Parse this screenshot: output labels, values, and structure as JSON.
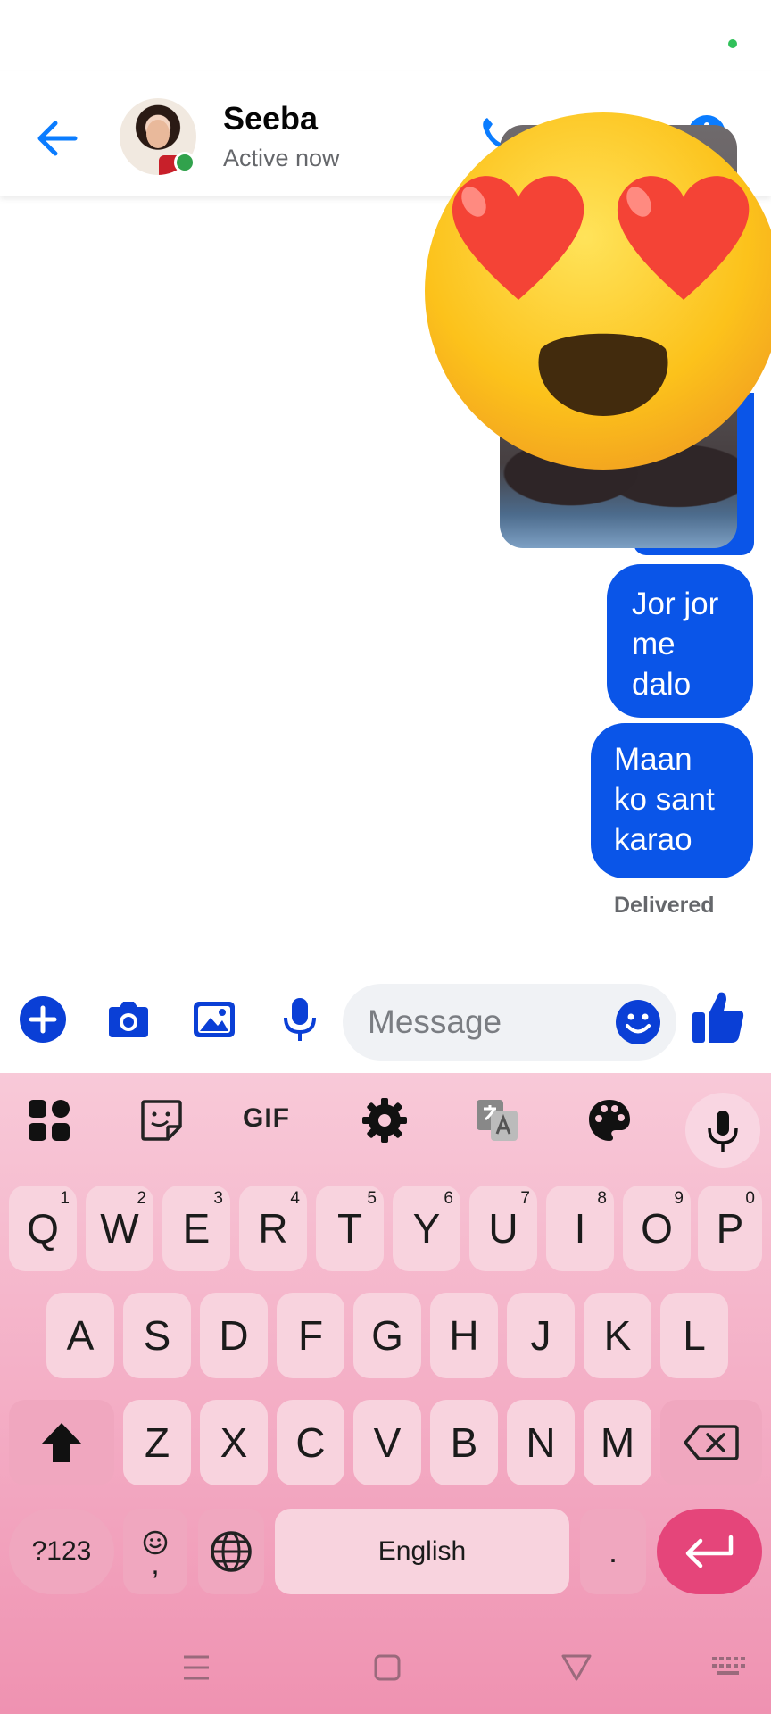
{
  "colors": {
    "accent": "#0a55e8",
    "messenger_blue": "#0a7cff",
    "online_green": "#31a24c",
    "keyboard_pink": "#f3a9c2",
    "enter_pink": "#e5457a"
  },
  "header": {
    "contact_name": "Seeba",
    "contact_status": "Active now",
    "icons": [
      "back-arrow-icon",
      "phone-icon",
      "info-icon"
    ]
  },
  "conversation": {
    "messages": [
      {
        "type": "photo",
        "sender": "me"
      },
      {
        "type": "text",
        "sender": "me",
        "lines": [
          "Jor jor",
          "me",
          "dalo"
        ]
      },
      {
        "type": "text",
        "sender": "me",
        "lines": [
          "Maan",
          "ko sant",
          "karao"
        ]
      }
    ],
    "receipt": "Delivered",
    "overlay_emoji": "smiling-face-with-heart-eyes"
  },
  "composer": {
    "placeholder": "Message",
    "icons": [
      "plus-icon",
      "camera-icon",
      "gallery-icon",
      "microphone-icon",
      "emoji-icon",
      "thumbs-up-icon"
    ]
  },
  "keyboard": {
    "toolbar": {
      "gif_label": "GIF",
      "icons": [
        "apps-grid-icon",
        "sticker-icon",
        "settings-icon",
        "translate-icon",
        "palette-icon",
        "microphone-icon"
      ]
    },
    "row1": [
      {
        "label": "Q",
        "hint": "1"
      },
      {
        "label": "W",
        "hint": "2"
      },
      {
        "label": "E",
        "hint": "3"
      },
      {
        "label": "R",
        "hint": "4"
      },
      {
        "label": "T",
        "hint": "5"
      },
      {
        "label": "Y",
        "hint": "6"
      },
      {
        "label": "U",
        "hint": "7"
      },
      {
        "label": "I",
        "hint": "8"
      },
      {
        "label": "O",
        "hint": "9"
      },
      {
        "label": "P",
        "hint": "0"
      }
    ],
    "row2": [
      "A",
      "S",
      "D",
      "F",
      "G",
      "H",
      "J",
      "K",
      "L"
    ],
    "row3": [
      "Z",
      "X",
      "C",
      "V",
      "B",
      "N",
      "M"
    ],
    "symbols_label": "?123",
    "comma_label": ",",
    "space_label": "English",
    "period_label": "."
  },
  "navbar": {
    "icons": [
      "menu-icon",
      "home-icon",
      "back-icon",
      "keyboard-hide-icon"
    ]
  }
}
